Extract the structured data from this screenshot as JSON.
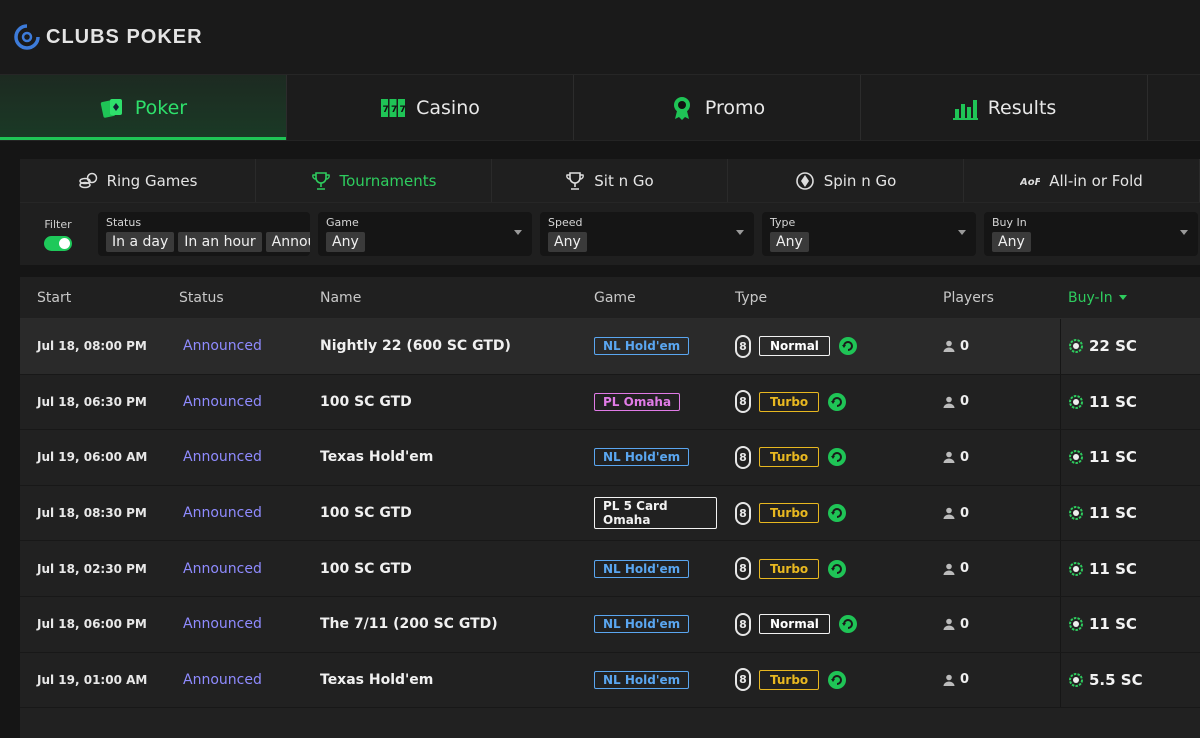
{
  "brand": {
    "name": "CLUBS POKER"
  },
  "main_nav": [
    {
      "label": "Poker",
      "icon": "cards-icon",
      "active": true
    },
    {
      "label": "Casino",
      "icon": "slots-icon",
      "active": false
    },
    {
      "label": "Promo",
      "icon": "medal-icon",
      "active": false
    },
    {
      "label": "Results",
      "icon": "chart-icon",
      "active": false
    }
  ],
  "sub_nav": [
    {
      "label": "Ring Games",
      "icon": "chips-icon",
      "active": false
    },
    {
      "label": "Tournaments",
      "icon": "trophy-icon",
      "active": true
    },
    {
      "label": "Sit n Go",
      "icon": "trophy-outline-icon",
      "active": false
    },
    {
      "label": "Spin n Go",
      "icon": "spin-icon",
      "active": false
    },
    {
      "label": "All-in or Fold",
      "icon": "aof-icon",
      "active": false
    }
  ],
  "filters": {
    "toggle_label": "Filter",
    "status": {
      "label": "Status",
      "chips": [
        "In a day",
        "In an hour",
        "Announ"
      ]
    },
    "game": {
      "label": "Game",
      "value": "Any"
    },
    "speed": {
      "label": "Speed",
      "value": "Any"
    },
    "type": {
      "label": "Type",
      "value": "Any"
    },
    "buyin": {
      "label": "Buy In",
      "value": "Any"
    }
  },
  "table": {
    "columns": {
      "start": "Start",
      "status": "Status",
      "name": "Name",
      "game": "Game",
      "type": "Type",
      "players": "Players",
      "buyin": "Buy-In"
    },
    "rows": [
      {
        "start": "Jul 18, 08:00 PM",
        "status": "Announced",
        "name": "Nightly 22 (600 SC GTD)",
        "game": "NL Hold'em",
        "game_style": "nl",
        "max": "8",
        "speed": "Normal",
        "players": "0",
        "buyin": "22 SC"
      },
      {
        "start": "Jul 18, 06:30 PM",
        "status": "Announced",
        "name": "100 SC GTD",
        "game": "PL Omaha",
        "game_style": "plo",
        "max": "8",
        "speed": "Turbo",
        "players": "0",
        "buyin": "11 SC"
      },
      {
        "start": "Jul 19, 06:00 AM",
        "status": "Announced",
        "name": "Texas Hold'em",
        "game": "NL Hold'em",
        "game_style": "nl",
        "max": "8",
        "speed": "Turbo",
        "players": "0",
        "buyin": "11 SC"
      },
      {
        "start": "Jul 18, 08:30 PM",
        "status": "Announced",
        "name": "100 SC GTD",
        "game": "PL 5 Card Omaha",
        "game_style": "pl5",
        "max": "8",
        "speed": "Turbo",
        "players": "0",
        "buyin": "11 SC"
      },
      {
        "start": "Jul 18, 02:30 PM",
        "status": "Announced",
        "name": "100 SC GTD",
        "game": "NL Hold'em",
        "game_style": "nl",
        "max": "8",
        "speed": "Turbo",
        "players": "0",
        "buyin": "11 SC"
      },
      {
        "start": "Jul 18, 06:00 PM",
        "status": "Announced",
        "name": "The 7/11 (200 SC GTD)",
        "game": "NL Hold'em",
        "game_style": "nl",
        "max": "8",
        "speed": "Normal",
        "players": "0",
        "buyin": "11 SC"
      },
      {
        "start": "Jul 19, 01:00 AM",
        "status": "Announced",
        "name": "Texas Hold'em",
        "game": "NL Hold'em",
        "game_style": "nl",
        "max": "8",
        "speed": "Turbo",
        "players": "0",
        "buyin": "5.5 SC"
      }
    ]
  },
  "colors": {
    "accent": "#2ecc5e",
    "status": "#8f8bff",
    "turbo": "#e8b820",
    "nl": "#5aa6f0",
    "plo": "#e07be6"
  }
}
